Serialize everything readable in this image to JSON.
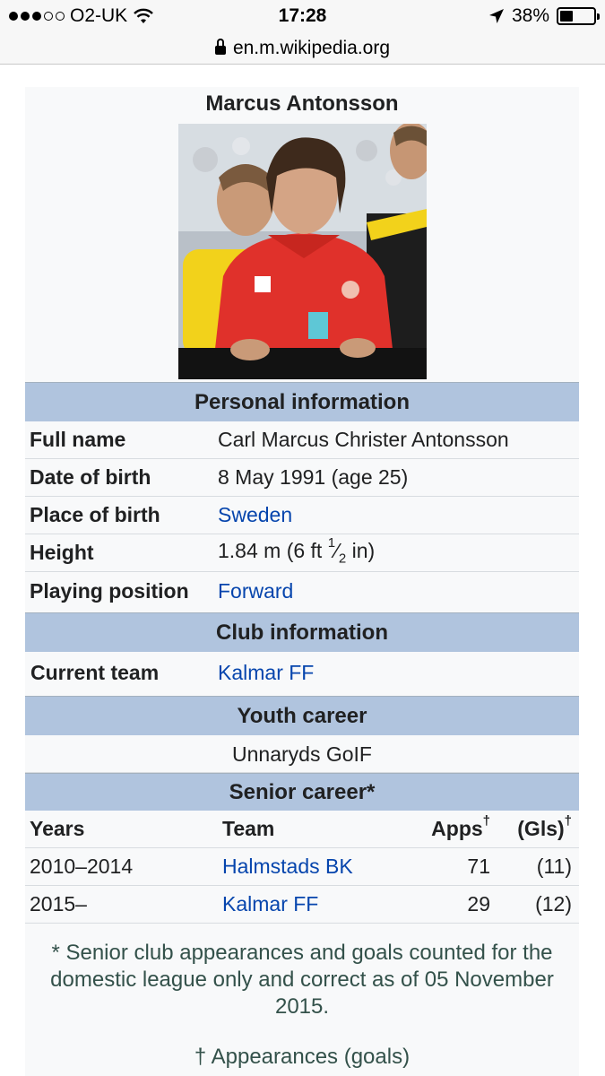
{
  "status_bar": {
    "carrier": "O2-UK",
    "time": "17:28",
    "battery_percent": "38%",
    "battery_level": 0.38
  },
  "browser": {
    "url": "en.m.wikipedia.org"
  },
  "infobox": {
    "title": "Marcus Antonsson",
    "sections": {
      "personal": "Personal information",
      "club": "Club information",
      "youth": "Youth career",
      "senior": "Senior career*"
    },
    "personal": {
      "full_name_label": "Full name",
      "full_name": "Carl Marcus Christer Antonsson",
      "dob_label": "Date of birth",
      "dob": "8 May 1991 (age 25)",
      "pob_label": "Place of birth",
      "pob": "Sweden",
      "height_label": "Height",
      "height_main": "1.84 m (6 ft ",
      "height_num": "1",
      "height_den": "2",
      "height_end": " in)",
      "position_label": "Playing position",
      "position": "Forward"
    },
    "club": {
      "current_team_label": "Current team",
      "current_team": "Kalmar FF"
    },
    "youth": {
      "team": "Unnaryds GoIF"
    },
    "senior": {
      "headers": {
        "years": "Years",
        "team": "Team",
        "apps": "Apps",
        "gls": "(Gls)",
        "dagger": "†"
      },
      "rows": [
        {
          "years": "2010–2014",
          "team": "Halmstads BK",
          "apps": "71",
          "gls": "(11)"
        },
        {
          "years": "2015–",
          "team": "Kalmar FF",
          "apps": "29",
          "gls": "(12)"
        }
      ]
    },
    "footnote": "* Senior club appearances and goals counted for the domestic league only and correct as of 05 November 2015.",
    "footnote2": "† Appearances (goals)"
  }
}
